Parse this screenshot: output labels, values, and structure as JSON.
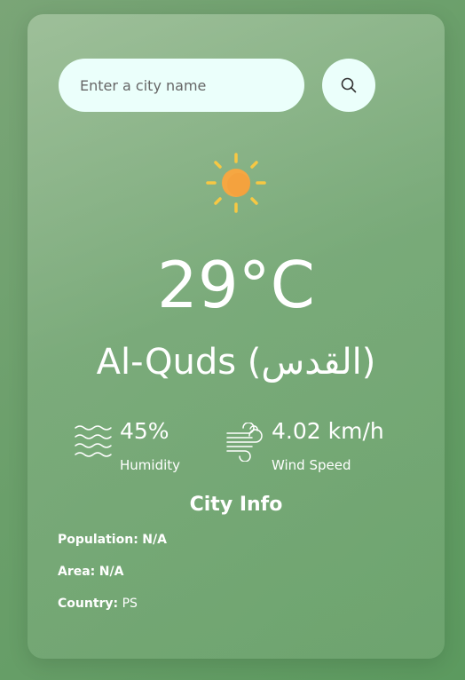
{
  "search": {
    "placeholder": "Enter a city name",
    "value": ""
  },
  "weather": {
    "icon": "sun-icon",
    "temperature": "29°C",
    "city": "Al-Quds (القدس)"
  },
  "details": {
    "humidity": {
      "value": "45%",
      "label": "Humidity",
      "icon": "humidity-waves-icon"
    },
    "wind": {
      "value": "4.02 km/h",
      "label": "Wind Speed",
      "icon": "wind-icon"
    }
  },
  "city_info": {
    "title": "City Info",
    "population_label": "Population:",
    "population_value": "N/A",
    "area_label": "Area:",
    "area_value": "N/A",
    "country_label": "Country:",
    "country_value": "PS"
  },
  "colors": {
    "card_text": "#ffffff",
    "input_bg": "#ebfffb",
    "sun_core": "#f5a742",
    "sun_rays": "#f7c843"
  }
}
